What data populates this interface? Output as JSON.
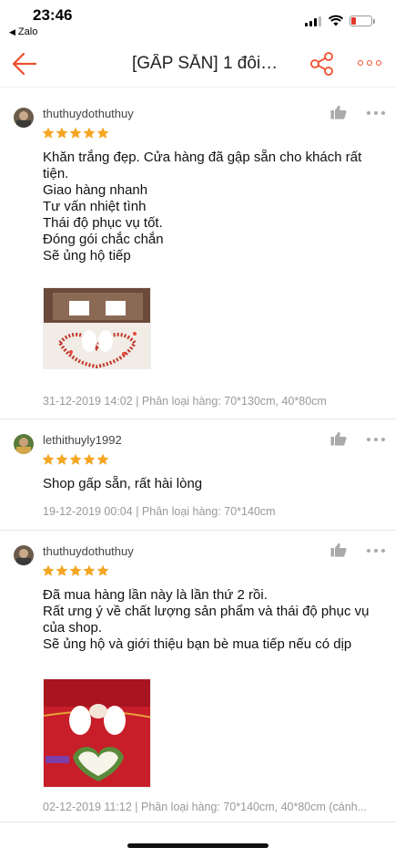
{
  "status_bar": {
    "time": "23:46",
    "back_app": "Zalo"
  },
  "nav": {
    "title": "[GẤP SẴN] 1 đôi…",
    "accent_color": "#ee4d2d"
  },
  "reviews": [
    {
      "username": "thuthuydothuthuy",
      "rating": 5,
      "comment": "Khăn trắng đẹp.  Cửa hàng đã gập sẵn cho khách rất tiện.\nGiao hàng nhanh\nTư vấn nhiệt tình\nThái độ phục vụ tốt.\nĐóng gói chắc chắn\nSẽ ủng hộ tiếp",
      "date": "31-12-2019 14:02",
      "variation": "Phân loại hàng: 70*130cm, 40*80cm"
    },
    {
      "username": "lethithuyly1992",
      "rating": 5,
      "comment": "Shop gấp sẵn, rất hài lòng",
      "date": "19-12-2019 00:04",
      "variation": "Phân loại hàng: 70*140cm"
    },
    {
      "username": "thuthuydothuthuy",
      "rating": 5,
      "comment": "Đã mua hàng lần này là lần thứ 2 rồi.\nRất ưng ý về chất lượng sản phẩm và thái độ phục vụ của shop.\nSẽ ủng hộ và giới thiệu bạn bè mua tiếp nếu có dịp",
      "date": "02-12-2019 11:12",
      "variation": "Phân loại hàng: 70*140cm, 40*80cm (cánh..."
    }
  ],
  "meta_separator": "|",
  "star_color": "#f5a623"
}
